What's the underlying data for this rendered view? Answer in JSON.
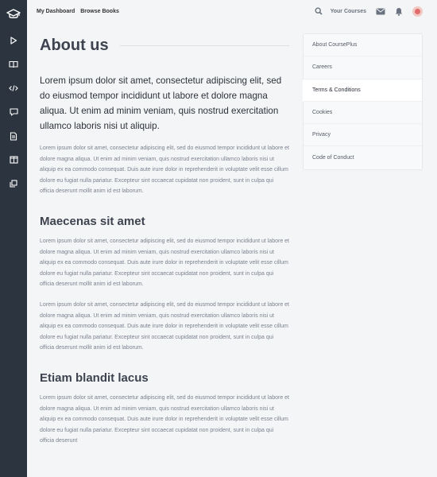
{
  "topnav": {
    "links": [
      "My Dashboard",
      "Browse Books"
    ],
    "courses_label": "Your Courses"
  },
  "sidebar": {
    "icons": [
      "graduation-cap-icon",
      "play-icon",
      "book-open-icon",
      "code-icon",
      "chat-icon",
      "document-icon",
      "columns-icon",
      "copy-icon"
    ]
  },
  "page": {
    "title": "About us",
    "lead": "Lorem ipsum dolor sit amet, consectetur adipiscing elit, sed do eiusmod tempor incididunt ut labore et dolore magna aliqua. Ut enim ad minim veniam, quis nostrud exercitation ullamco laboris nisi ut aliquip.",
    "paragraphs": [
      "Lorem ipsum dolor sit amet, consectetur adipiscing elit, sed do eiusmod tempor incididunt ut labore et dolore magna aliqua. Ut enim ad minim veniam, quis nostrud exercitation ullamco laboris nisi ut aliquip ex ea commodo consequat. Duis aute irure dolor in reprehenderit in voluptate velit esse cillum dolore eu fugiat nulla pariatur. Excepteur sint occaecat cupidatat non proident, sunt in culpa qui officia deserunt mollit anim id est laborum.",
      "Lorem ipsum dolor sit amet, consectetur adipiscing elit, sed do eiusmod tempor incididunt ut labore et dolore magna aliqua. Ut enim ad minim veniam, quis nostrud exercitation ullamco laboris nisi ut aliquip ex ea commodo consequat. Duis aute irure dolor in reprehenderit in voluptate velit esse cillum dolore eu fugiat nulla pariatur. Excepteur sint occaecat cupidatat non proident, sunt in culpa qui officia deserunt mollit anim id est laborum.",
      "Lorem ipsum dolor sit amet, consectetur adipiscing elit, sed do eiusmod tempor incididunt ut labore et dolore magna aliqua. Ut enim ad minim veniam, quis nostrud exercitation ullamco laboris nisi ut aliquip ex ea commodo consequat. Duis aute irure dolor in reprehenderit in voluptate velit esse cillum dolore eu fugiat nulla pariatur. Excepteur sint occaecat cupidatat non proident, sunt in culpa qui officia deserunt mollit anim id est laborum.",
      "Lorem ipsum dolor sit amet, consectetur adipiscing elit, sed do eiusmod tempor incididunt ut labore et dolore magna aliqua. Ut enim ad minim veniam, quis nostrud exercitation ullamco laboris nisi ut aliquip ex ea commodo consequat. Duis aute irure dolor in reprehenderit in voluptate velit esse cillum dolore eu fugiat nulla pariatur. Excepteur sint occaecat cupidatat non proident, sunt in culpa qui officia deserunt"
    ],
    "headings": [
      "Maecenas sit amet",
      "Etiam blandit lacus"
    ]
  },
  "side_menu": {
    "items": [
      "About CoursePlus",
      "Careers",
      "Terms & Conditions",
      "Cookies",
      "Privacy",
      "Code of Conduct"
    ],
    "active": "Terms & Conditions"
  },
  "colors": {
    "sidebar_bg": "#2c343f",
    "page_bg": "#f4f5f6"
  }
}
